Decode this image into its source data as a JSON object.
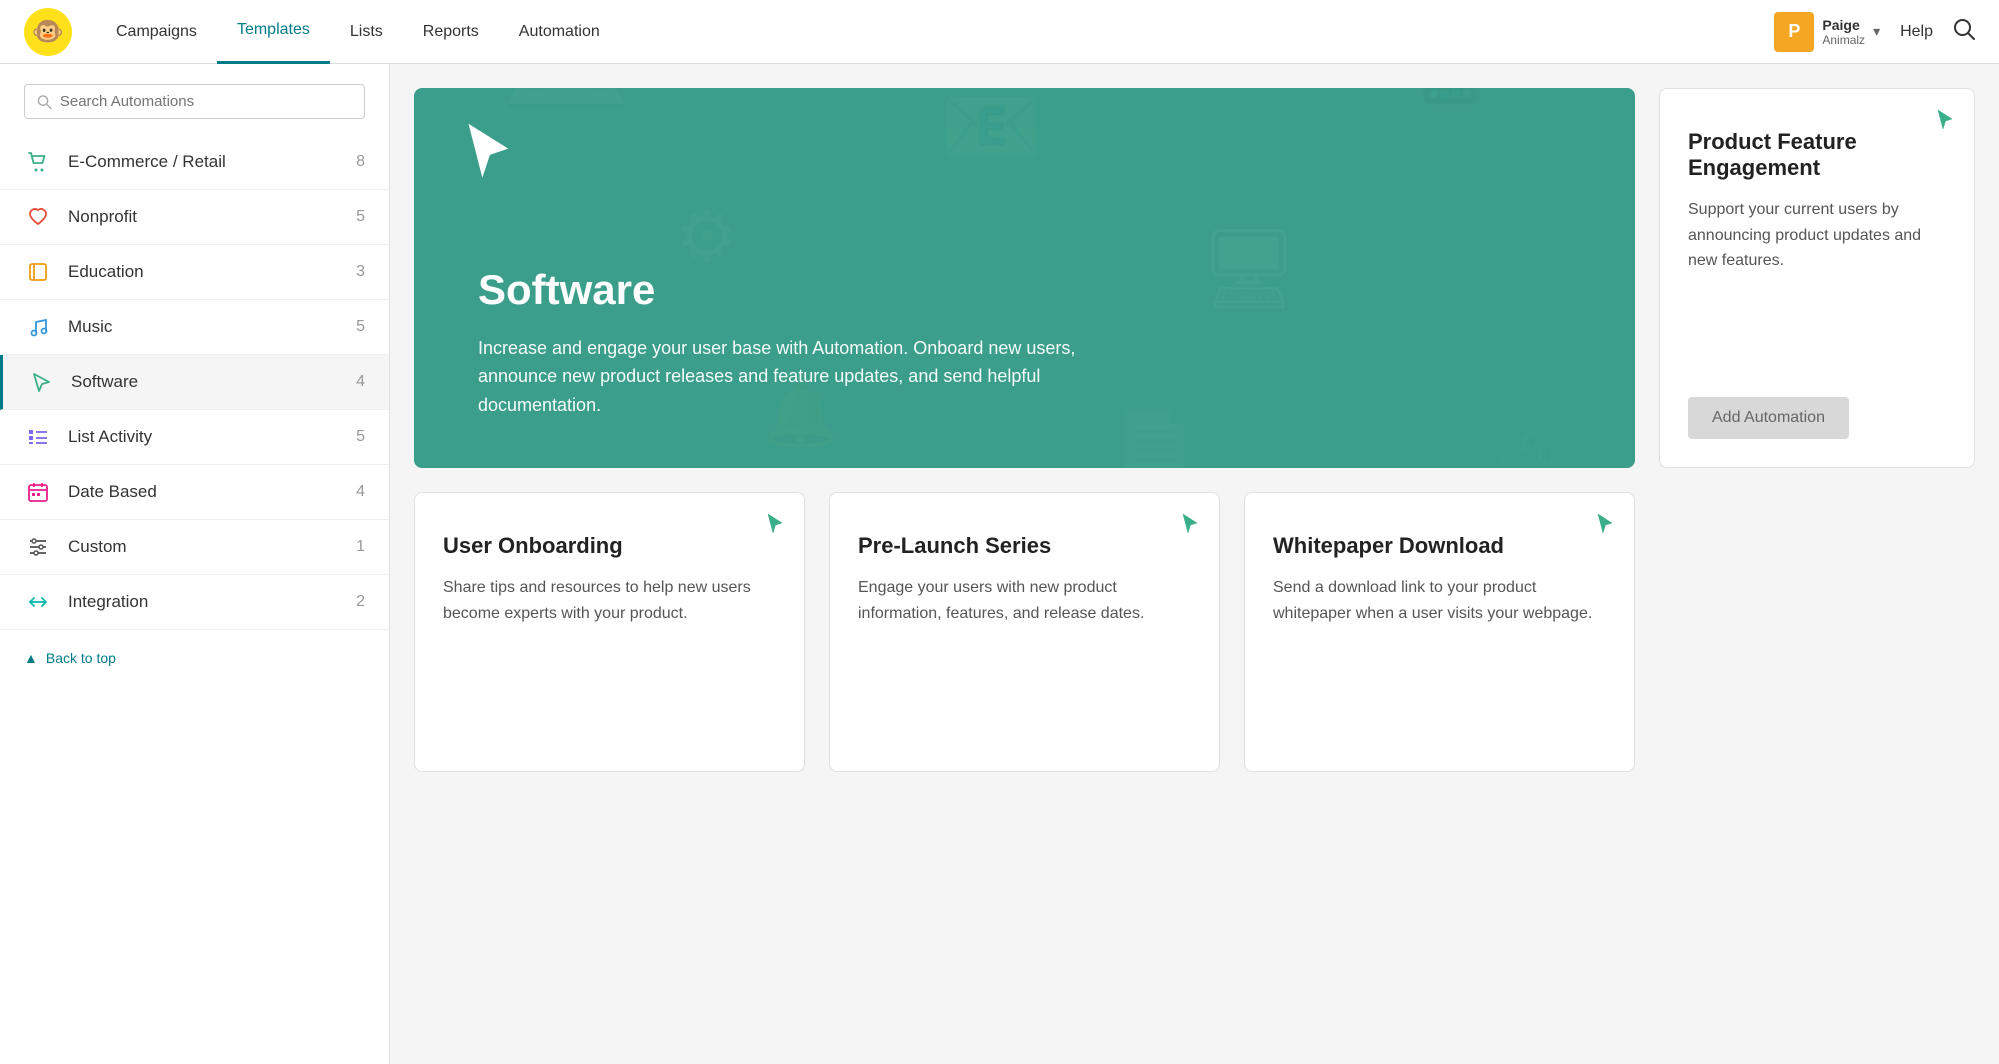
{
  "header": {
    "nav_items": [
      {
        "label": "Campaigns",
        "active": false
      },
      {
        "label": "Templates",
        "active": true
      },
      {
        "label": "Lists",
        "active": false
      },
      {
        "label": "Reports",
        "active": false
      },
      {
        "label": "Automation",
        "active": false
      }
    ],
    "user": {
      "initial": "P",
      "name": "Paige",
      "org": "Animalz"
    },
    "help_label": "Help"
  },
  "sidebar": {
    "search_placeholder": "Search Automations",
    "items": [
      {
        "id": "ecommerce",
        "label": "E-Commerce / Retail",
        "count": 8,
        "icon": "cart",
        "active": false
      },
      {
        "id": "nonprofit",
        "label": "Nonprofit",
        "count": 5,
        "icon": "heart",
        "active": false
      },
      {
        "id": "education",
        "label": "Education",
        "count": 3,
        "icon": "book",
        "active": false
      },
      {
        "id": "music",
        "label": "Music",
        "count": 5,
        "icon": "music",
        "active": false
      },
      {
        "id": "software",
        "label": "Software",
        "count": 4,
        "icon": "cursor",
        "active": true
      },
      {
        "id": "list-activity",
        "label": "List Activity",
        "count": 5,
        "icon": "list",
        "active": false
      },
      {
        "id": "date-based",
        "label": "Date Based",
        "count": 4,
        "icon": "calendar",
        "active": false
      },
      {
        "id": "custom",
        "label": "Custom",
        "count": 1,
        "icon": "sliders",
        "active": false
      },
      {
        "id": "integration",
        "label": "Integration",
        "count": 2,
        "icon": "arrows",
        "active": false
      }
    ],
    "back_to_top": "Back to top"
  },
  "hero": {
    "title": "Software",
    "description": "Increase and engage your user base with Automation. Onboard new users, announce new product releases and feature updates, and send helpful documentation."
  },
  "featured_card": {
    "title": "Product Feature Engagement",
    "description": "Support your current users by announcing product updates and new features.",
    "add_button_label": "Add Automation"
  },
  "automation_cards": [
    {
      "title": "User Onboarding",
      "description": "Share tips and resources to help new users become experts with your product."
    },
    {
      "title": "Pre-Launch Series",
      "description": "Engage your users with new product information, features, and release dates."
    },
    {
      "title": "Whitepaper Download",
      "description": "Send a download link to your product whitepaper when a user visits your webpage."
    }
  ]
}
